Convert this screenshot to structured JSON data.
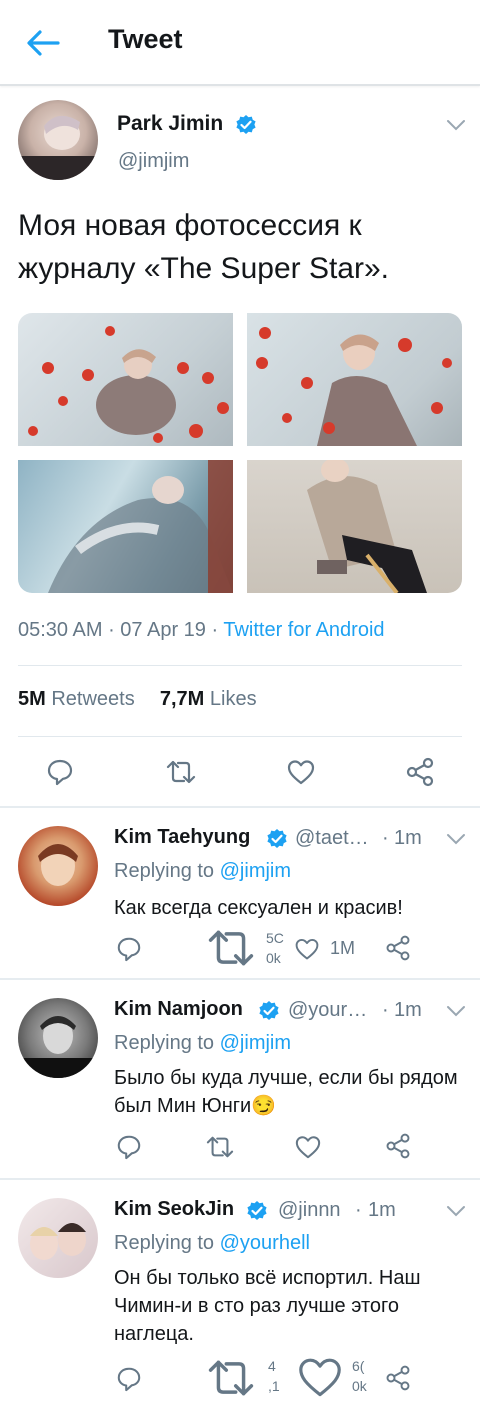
{
  "header": {
    "title": "Tweet",
    "back_icon": "arrow-left-icon"
  },
  "colors": {
    "accent": "#1da1f2",
    "text": "#14171a",
    "muted": "#657786"
  },
  "tweet": {
    "author_name": "Park Jimin",
    "author_handle": "@jimjim",
    "text": "Моя новая фотосессия к журналу «The Super Star».",
    "time": "05:30 AM",
    "date": "07 Apr 19",
    "source": "Twitter for Android",
    "retweets": "5M",
    "retweets_label": "Retweets",
    "likes": "7,7M",
    "likes_label": "Likes"
  },
  "replies": [
    {
      "name": "Kim Taehyung",
      "handle": "@taet…",
      "time": "1m",
      "replying_label": "Replying to",
      "replying_to": "@jimjim",
      "text": "Как всегда сексуален и красив!",
      "retweets": "5C",
      "retweets_line2": "0k",
      "likes": "1M"
    },
    {
      "name": "Kim Namjoon",
      "handle": "@your…",
      "time": "1m",
      "replying_label": "Replying to",
      "replying_to": "@jimjim",
      "text": "Было бы куда лучше, если бы рядом был Мин Юнги😏"
    },
    {
      "name": "Kim SeokJin",
      "handle": "@jinnn",
      "time": "1m",
      "replying_label": "Replying to",
      "replying_to": "@yourhell",
      "text": "Он бы только всё испортил. Наш Чимин-и в сто раз лучше этого наглеца.",
      "retweets": "4",
      "retweets_line2": ",1",
      "likes": "6(",
      "likes_line2": "0k"
    }
  ]
}
